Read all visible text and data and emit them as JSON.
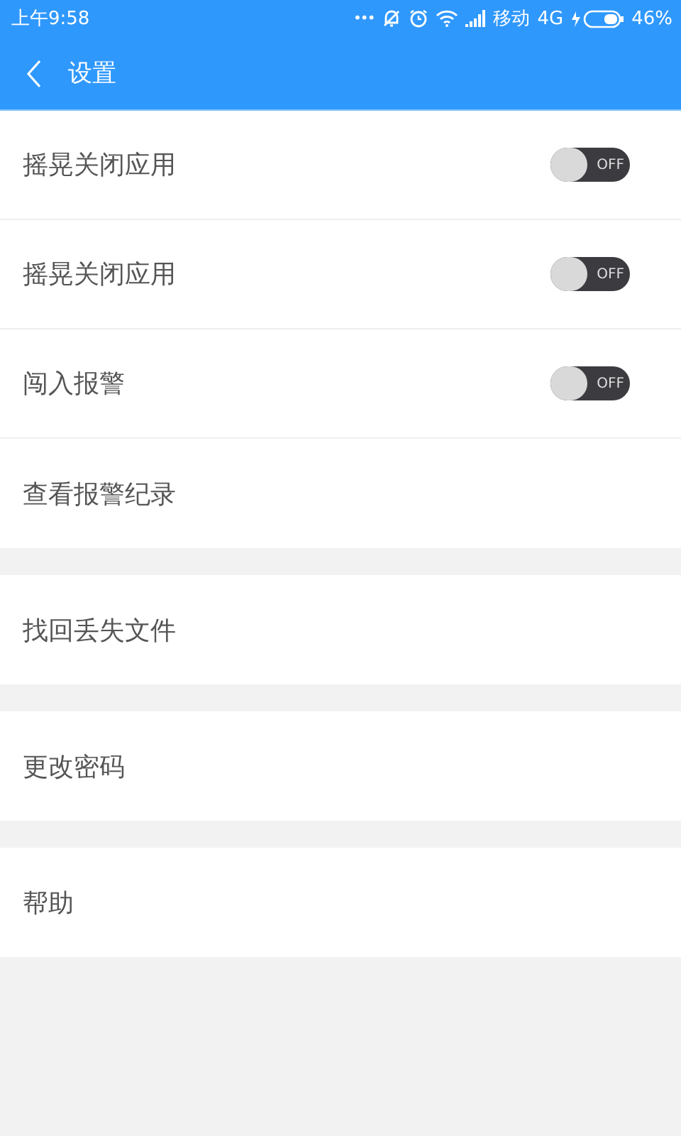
{
  "status_bar": {
    "time": "上午9:58",
    "dots": "•••",
    "carrier": "移动",
    "network": "4G",
    "battery": "46%"
  },
  "header": {
    "title": "设置"
  },
  "sections": [
    {
      "items": [
        {
          "kind": "toggle",
          "label": "摇晃关闭应用",
          "on": false,
          "switch_text": "OFF"
        },
        {
          "kind": "toggle",
          "label": "摇晃关闭应用",
          "on": false,
          "switch_text": "OFF"
        },
        {
          "kind": "toggle",
          "label": "闯入报警",
          "on": false,
          "switch_text": "OFF"
        },
        {
          "kind": "link",
          "label": "查看报警纪录"
        }
      ]
    },
    {
      "items": [
        {
          "kind": "link",
          "label": "找回丢失文件"
        }
      ]
    },
    {
      "items": [
        {
          "kind": "link",
          "label": "更改密码"
        }
      ]
    },
    {
      "items": [
        {
          "kind": "link",
          "label": "帮助"
        }
      ]
    }
  ]
}
